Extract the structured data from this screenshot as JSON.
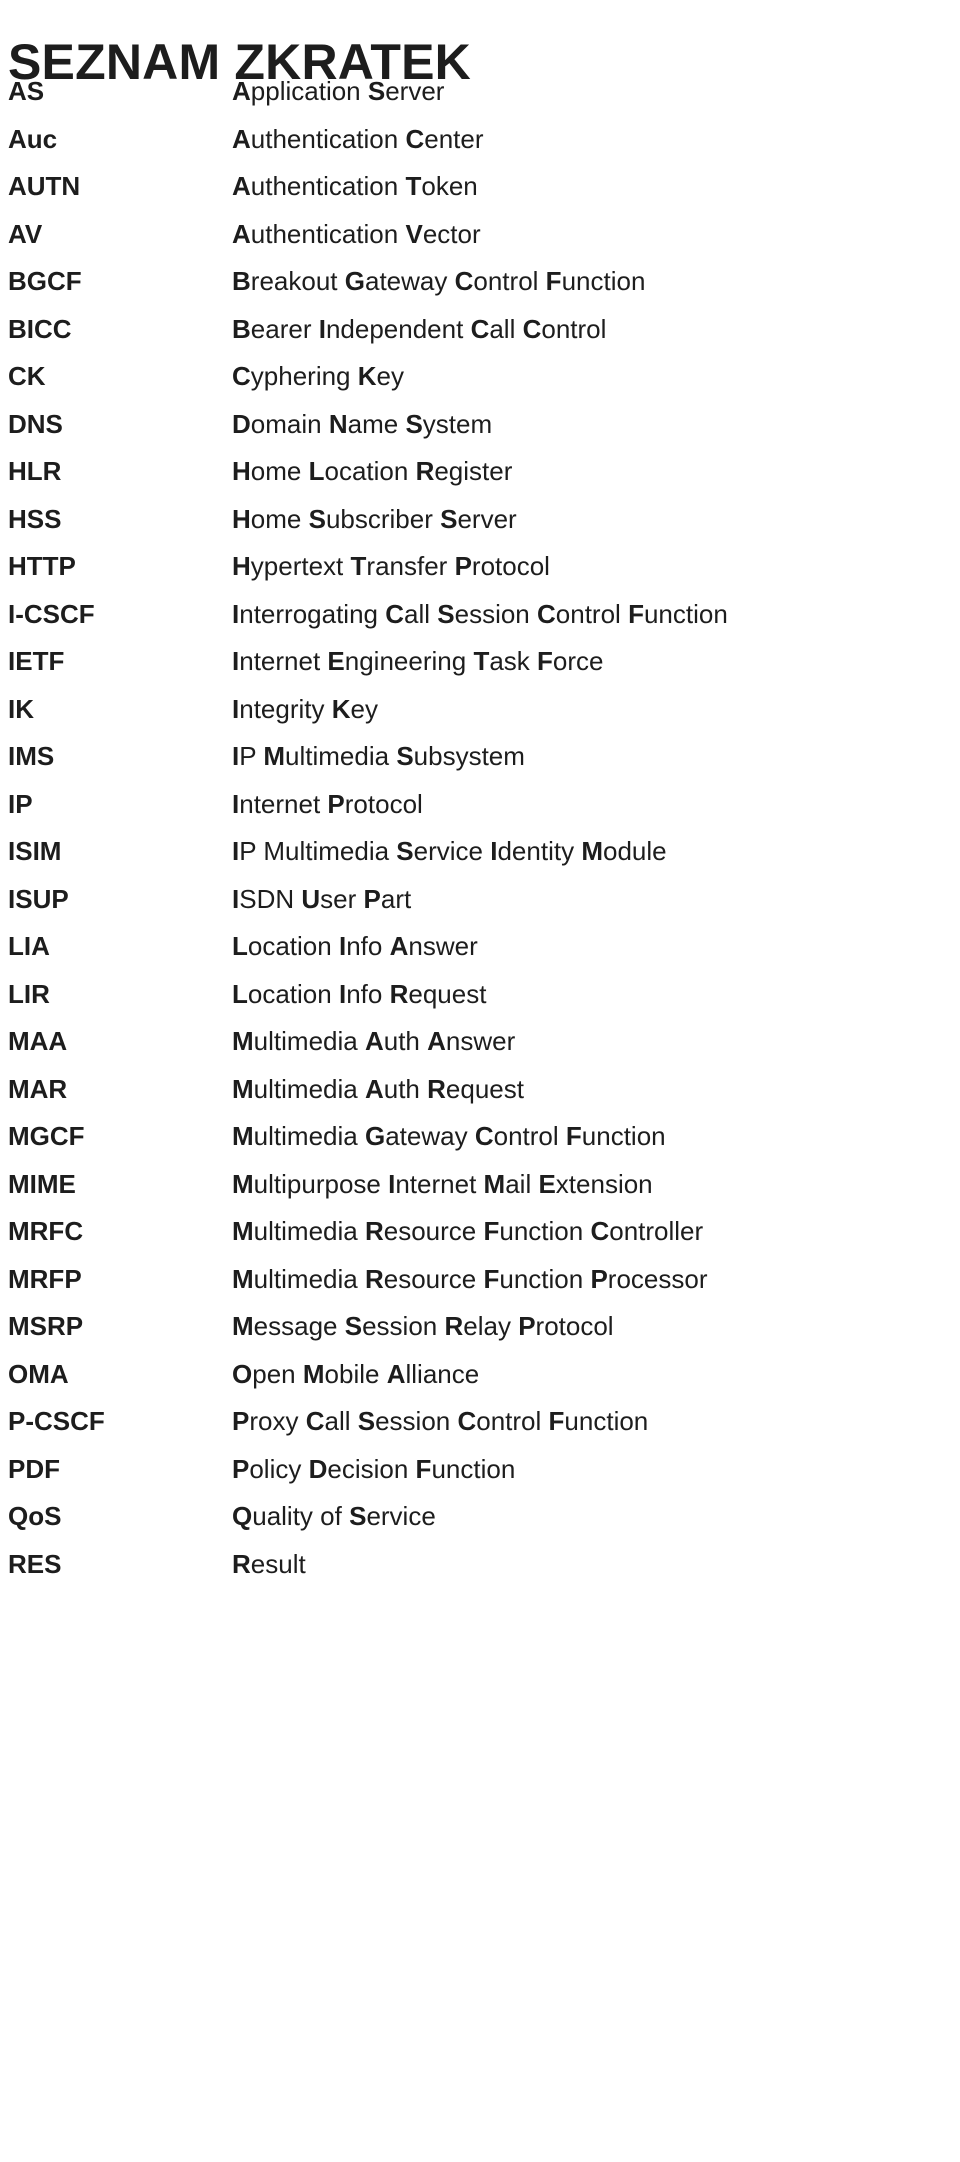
{
  "document": {
    "title": "SEZNAM ZKRATEK",
    "text_color": "#1d1d1d",
    "background_color": "#ffffff"
  },
  "abbreviations": [
    {
      "term": "AS",
      "definition": "Application Server",
      "bold_initials": [
        "A",
        "S"
      ]
    },
    {
      "term": "Auc",
      "definition": "Authentication Center",
      "bold_initials": [
        "A",
        "C"
      ]
    },
    {
      "term": "AUTN",
      "definition": "Authentication Token",
      "bold_initials": [
        "A",
        "T"
      ]
    },
    {
      "term": "AV",
      "definition": "Authentication Vector",
      "bold_initials": [
        "A",
        "V"
      ]
    },
    {
      "term": "BGCF",
      "definition": "Breakout Gateway Control Function",
      "bold_initials": [
        "B",
        "G",
        "C",
        "F"
      ]
    },
    {
      "term": "BICC",
      "definition": "Bearer Independent Call Control",
      "bold_initials": [
        "B",
        "I",
        "C",
        "C"
      ]
    },
    {
      "term": "CK",
      "definition": "Cyphering Key",
      "bold_initials": [
        "C",
        "K"
      ]
    },
    {
      "term": "DNS",
      "definition": "Domain Name System",
      "bold_initials": [
        "D",
        "N",
        "S"
      ]
    },
    {
      "term": "HLR",
      "definition": "Home Location Register",
      "bold_initials": [
        "H",
        "L",
        "R"
      ]
    },
    {
      "term": "HSS",
      "definition": "Home Subscriber Server",
      "bold_initials": [
        "H",
        "S",
        "S"
      ]
    },
    {
      "term": "HTTP",
      "definition": "Hypertext Transfer Protocol",
      "bold_initials": [
        "H",
        "T",
        "P"
      ]
    },
    {
      "term": "I-CSCF",
      "definition": "Interrogating Call Session Control Function",
      "bold_initials": [
        "I",
        "C",
        "S",
        "C",
        "F"
      ]
    },
    {
      "term": "IETF",
      "definition": "Internet Engineering Task Force",
      "bold_initials": [
        "I",
        "E",
        "T",
        "F"
      ]
    },
    {
      "term": "IK",
      "definition": "Integrity Key",
      "bold_initials": [
        "I",
        "K"
      ]
    },
    {
      "term": "IMS",
      "definition": "IP Multimedia Subsystem",
      "bold_initials": [
        "I",
        "M",
        "S"
      ]
    },
    {
      "term": "IP",
      "definition": "Internet Protocol",
      "bold_initials": [
        "I",
        "P"
      ]
    },
    {
      "term": "ISIM",
      "definition": "IP Multimedia Service Identity Module",
      "bold_initials": [
        "I",
        "S",
        "I",
        "M"
      ]
    },
    {
      "term": "ISUP",
      "definition": "ISDN User Part",
      "bold_initials": [
        "I",
        "U",
        "P"
      ]
    },
    {
      "term": "LIA",
      "definition": "Location Info Answer",
      "bold_initials": [
        "L",
        "I",
        "A"
      ]
    },
    {
      "term": "LIR",
      "definition": "Location Info Request",
      "bold_initials": [
        "L",
        "I",
        "R"
      ]
    },
    {
      "term": "MAA",
      "definition": "Multimedia Auth Answer",
      "bold_initials": [
        "M",
        "A",
        "A"
      ]
    },
    {
      "term": "MAR",
      "definition": "Multimedia Auth Request",
      "bold_initials": [
        "M",
        "A",
        "R"
      ]
    },
    {
      "term": "MGCF",
      "definition": "Multimedia Gateway Control Function",
      "bold_initials": [
        "M",
        "G",
        "C",
        "F"
      ]
    },
    {
      "term": "MIME",
      "definition": "Multipurpose Internet Mail Extension",
      "bold_initials": [
        "M",
        "I",
        "M",
        "E"
      ]
    },
    {
      "term": "MRFC",
      "definition": "Multimedia Resource Function Controller",
      "bold_initials": [
        "M",
        "R",
        "F",
        "C"
      ]
    },
    {
      "term": "MRFP",
      "definition": "Multimedia Resource Function Processor",
      "bold_initials": [
        "M",
        "R",
        "F",
        "P"
      ]
    },
    {
      "term": "MSRP",
      "definition": "Message Session Relay Protocol",
      "bold_initials": [
        "M",
        "S",
        "R",
        "P"
      ]
    },
    {
      "term": "OMA",
      "definition": "Open Mobile Alliance",
      "bold_initials": [
        "O",
        "M",
        "A"
      ]
    },
    {
      "term": "P-CSCF",
      "definition": "Proxy Call Session Control Function",
      "bold_initials": [
        "P",
        "C",
        "S",
        "C",
        "F"
      ]
    },
    {
      "term": "PDF",
      "definition": "Policy Decision Function",
      "bold_initials": [
        "P",
        "D",
        "F"
      ]
    },
    {
      "term": "QoS",
      "definition": "Quality of Service",
      "bold_initials": [
        "Q",
        "S"
      ]
    },
    {
      "term": "RES",
      "definition": "Result",
      "bold_initials": [
        "R"
      ]
    }
  ]
}
